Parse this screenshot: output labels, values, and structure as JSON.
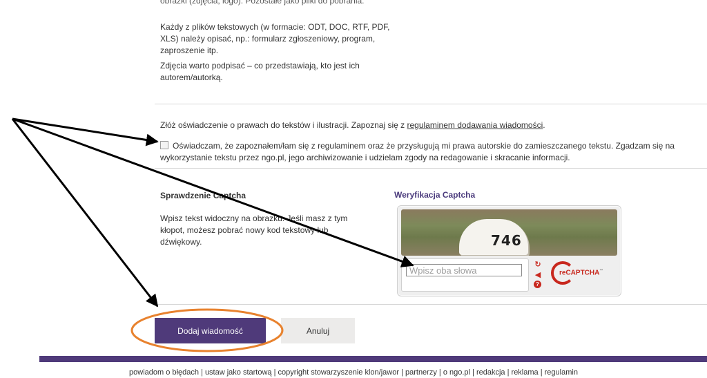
{
  "content": {
    "partial_line": "obrazki (zdjęcia, logo). Pozostałe jako pliki do pobrania.",
    "para_files": "Każdy z plików tekstowych (w formacie: ODT, DOC, RTF, PDF, XLS) należy opisać, np.: formularz zgłoszeniowy, program, zaproszenie itp.",
    "para_photos": "Zdjęcia warto podpisać – co przedstawiają, kto jest ich autorem/autorką."
  },
  "consent": {
    "intro": "Złóż oświadczenie o prawach do tekstów i ilustracji. Zapoznaj się z ",
    "link_text": "regulaminem dodawania wiadomości",
    "intro_end": ".",
    "checkbox_label": "Oświadczam, że zapoznałem/łam się z regulaminem oraz że przysługują mi prawa autorskie do zamieszczanego tekstu. Zgadzam się na wykorzystanie tekstu przez ngo.pl, jego archiwizowanie i udzielam zgody na redagowanie i skracanie informacji.",
    "checked": false
  },
  "captcha": {
    "section_title": "Sprawdzenie Captcha",
    "description": "Wpisz tekst widoczny na obrazku. Jeśli masz z tym kłopot, możesz pobrać nowy kod tekstowy lub dźwiękowy.",
    "widget_title": "Weryfikacja Captcha",
    "image_text": "746",
    "input_placeholder": "Wpisz oba słowa",
    "input_value": "",
    "logo_text": "reCAPTCHA",
    "logo_tm": "™"
  },
  "buttons": {
    "submit_label": "Dodaj wiadomość",
    "cancel_label": "Anuluj"
  },
  "footer": {
    "links": [
      "powiadom o błędach",
      "ustaw jako startową",
      "copyright stowarzyszenie klon/jawor",
      "partnerzy",
      "o ngo.pl",
      "redakcja",
      "reklama",
      "regulamin"
    ],
    "separator": " | "
  },
  "colors": {
    "brand_purple": "#4f3a7a",
    "annotation_orange": "#e8822e",
    "recaptcha_red": "#c8281e"
  },
  "icons": {
    "reload": "reload-icon",
    "audio": "audio-icon",
    "help": "help-icon"
  }
}
